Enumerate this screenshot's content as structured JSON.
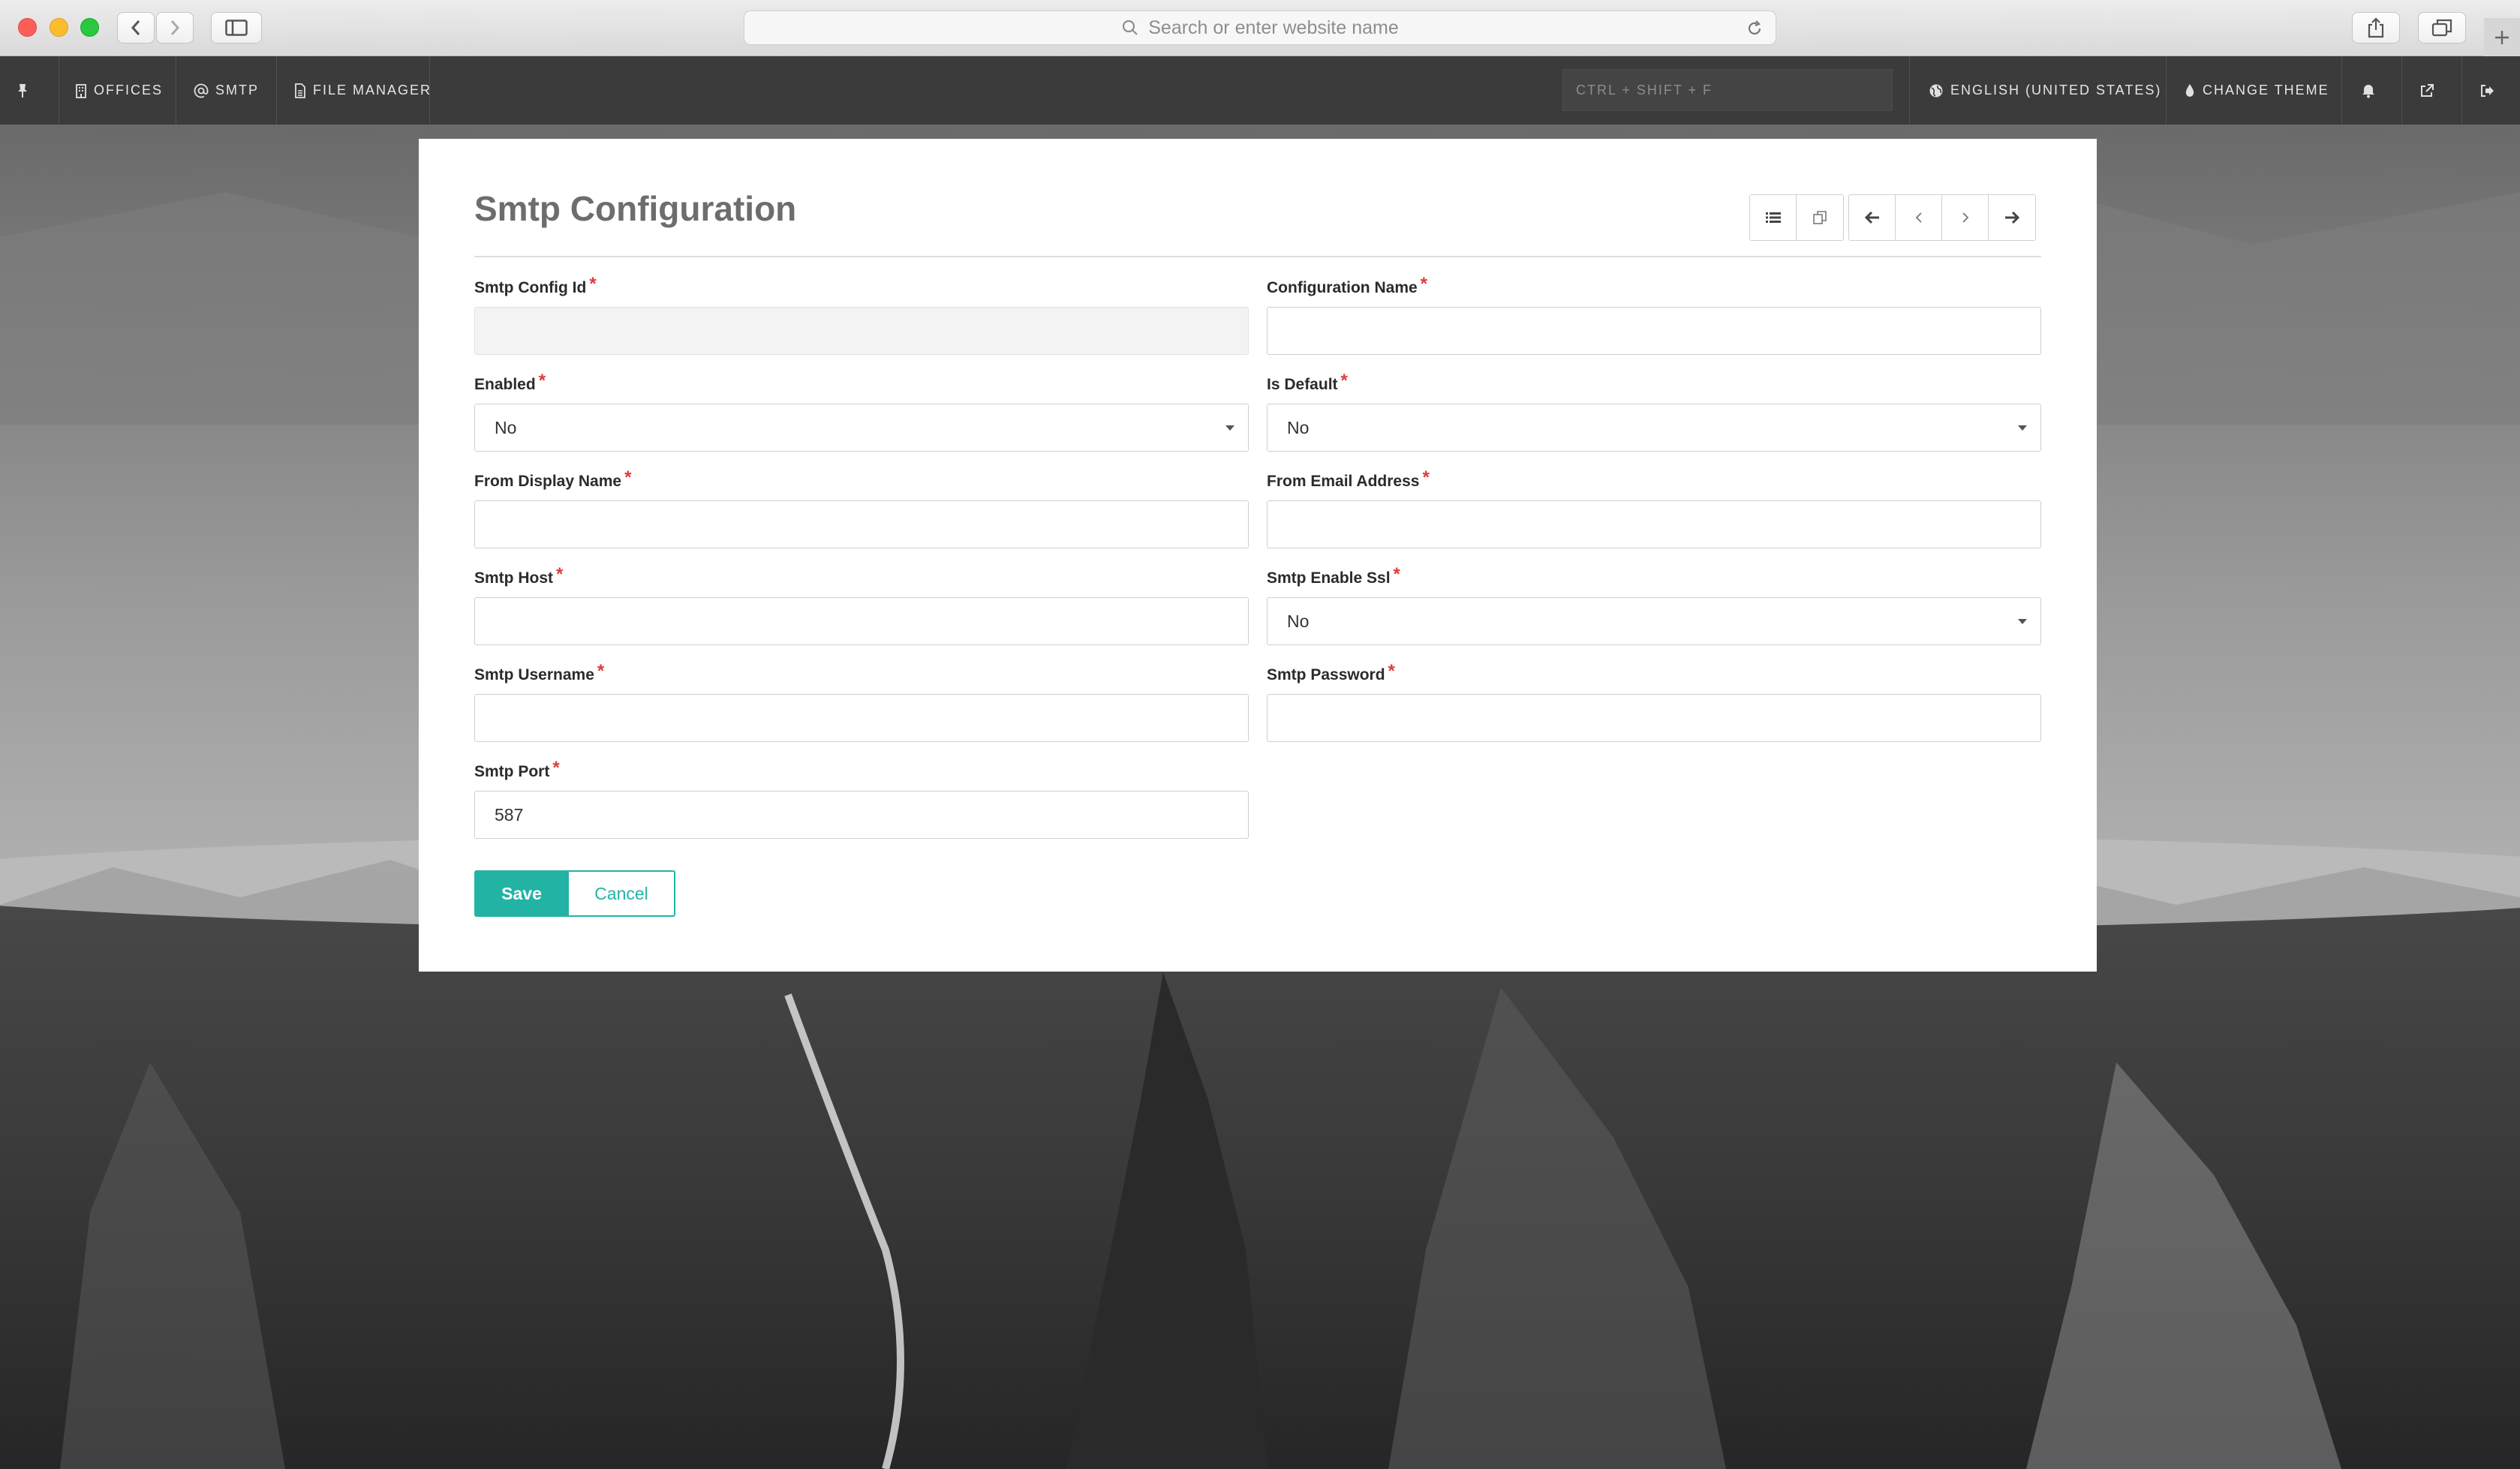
{
  "browser": {
    "address_placeholder": "Search or enter website name"
  },
  "nav": {
    "items": [
      {
        "label": "OFFICES",
        "icon": "building-icon"
      },
      {
        "label": "SMTP",
        "icon": "at-icon"
      },
      {
        "label": "FILE MANAGER",
        "icon": "file-icon"
      }
    ],
    "shortcut_hint": "CTRL + SHIFT + F",
    "language": "ENGLISH (UNITED STATES)",
    "theme": "CHANGE THEME"
  },
  "form": {
    "title": "Smtp Configuration",
    "required_mark": "*",
    "fields": {
      "smtp_config_id": {
        "label": "Smtp Config Id",
        "value": ""
      },
      "configuration_name": {
        "label": "Configuration Name",
        "value": ""
      },
      "enabled": {
        "label": "Enabled",
        "value": "No"
      },
      "is_default": {
        "label": "Is Default",
        "value": "No"
      },
      "from_display_name": {
        "label": "From Display Name",
        "value": ""
      },
      "from_email_address": {
        "label": "From Email Address",
        "value": ""
      },
      "smtp_host": {
        "label": "Smtp Host",
        "value": ""
      },
      "smtp_enable_ssl": {
        "label": "Smtp Enable Ssl",
        "value": "No"
      },
      "smtp_username": {
        "label": "Smtp Username",
        "value": ""
      },
      "smtp_password": {
        "label": "Smtp Password",
        "value": ""
      },
      "smtp_port": {
        "label": "Smtp Port",
        "value": "587"
      }
    },
    "save_label": "Save",
    "cancel_label": "Cancel"
  },
  "colors": {
    "accent": "#23b3a5",
    "required": "#e03b3b",
    "nav_bg": "#3b3b3b"
  }
}
